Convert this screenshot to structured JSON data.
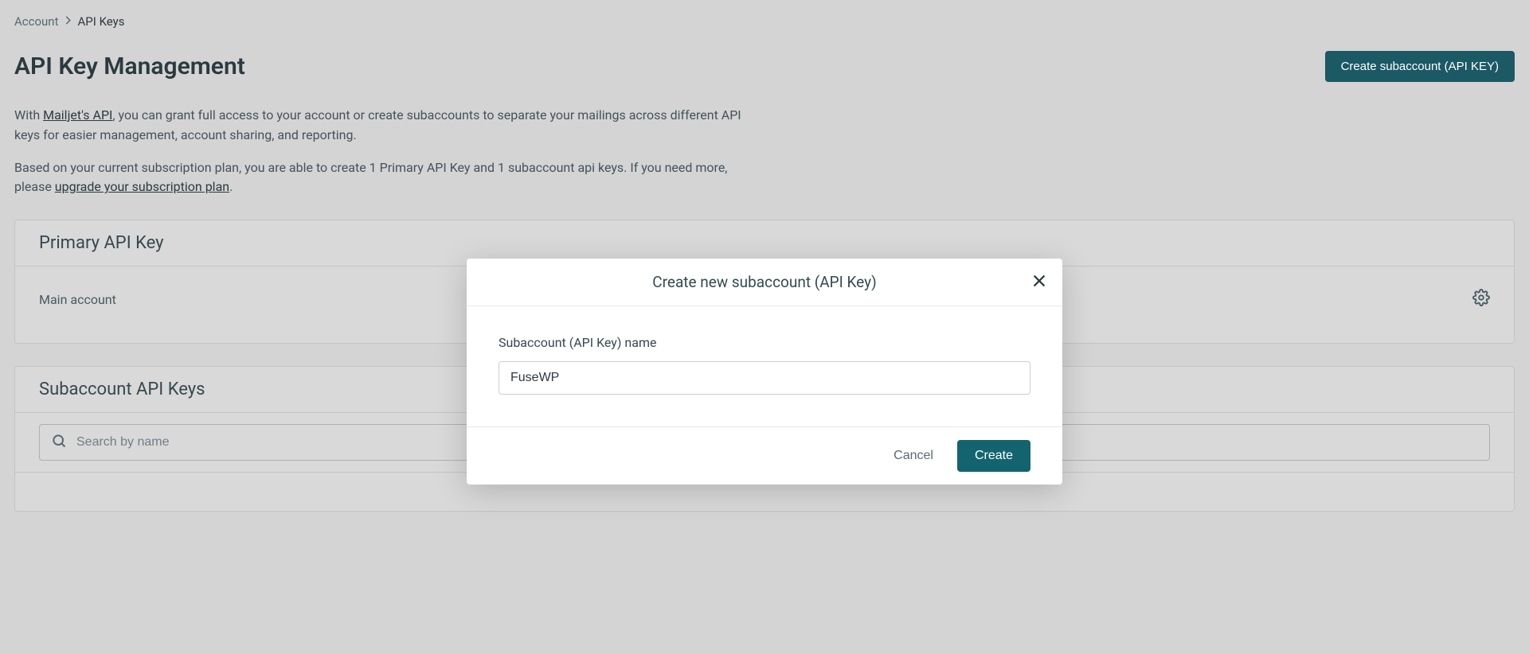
{
  "breadcrumb": {
    "parent": "Account",
    "current": "API Keys"
  },
  "page": {
    "title": "API Key Management",
    "create_button": "Create subaccount (API KEY)"
  },
  "desc1": {
    "prefix": "With ",
    "link": "Mailjet's API",
    "suffix": ", you can grant full access to your account or create subaccounts to separate your mailings across different API keys for easier management, account sharing, and reporting."
  },
  "desc2": {
    "prefix": "Based on your current subscription plan, you are able to create 1 Primary API Key and 1 subaccount api keys. If you need more, please ",
    "link": "upgrade your subscription plan",
    "suffix": "."
  },
  "primary_card": {
    "title": "Primary API Key",
    "account_name": "Main account"
  },
  "sub_card": {
    "title": "Subaccount API Keys",
    "search_placeholder": "Search by name"
  },
  "modal": {
    "title": "Create new subaccount (API Key)",
    "label": "Subaccount (API Key) name",
    "value": "FuseWP",
    "cancel": "Cancel",
    "create": "Create"
  }
}
